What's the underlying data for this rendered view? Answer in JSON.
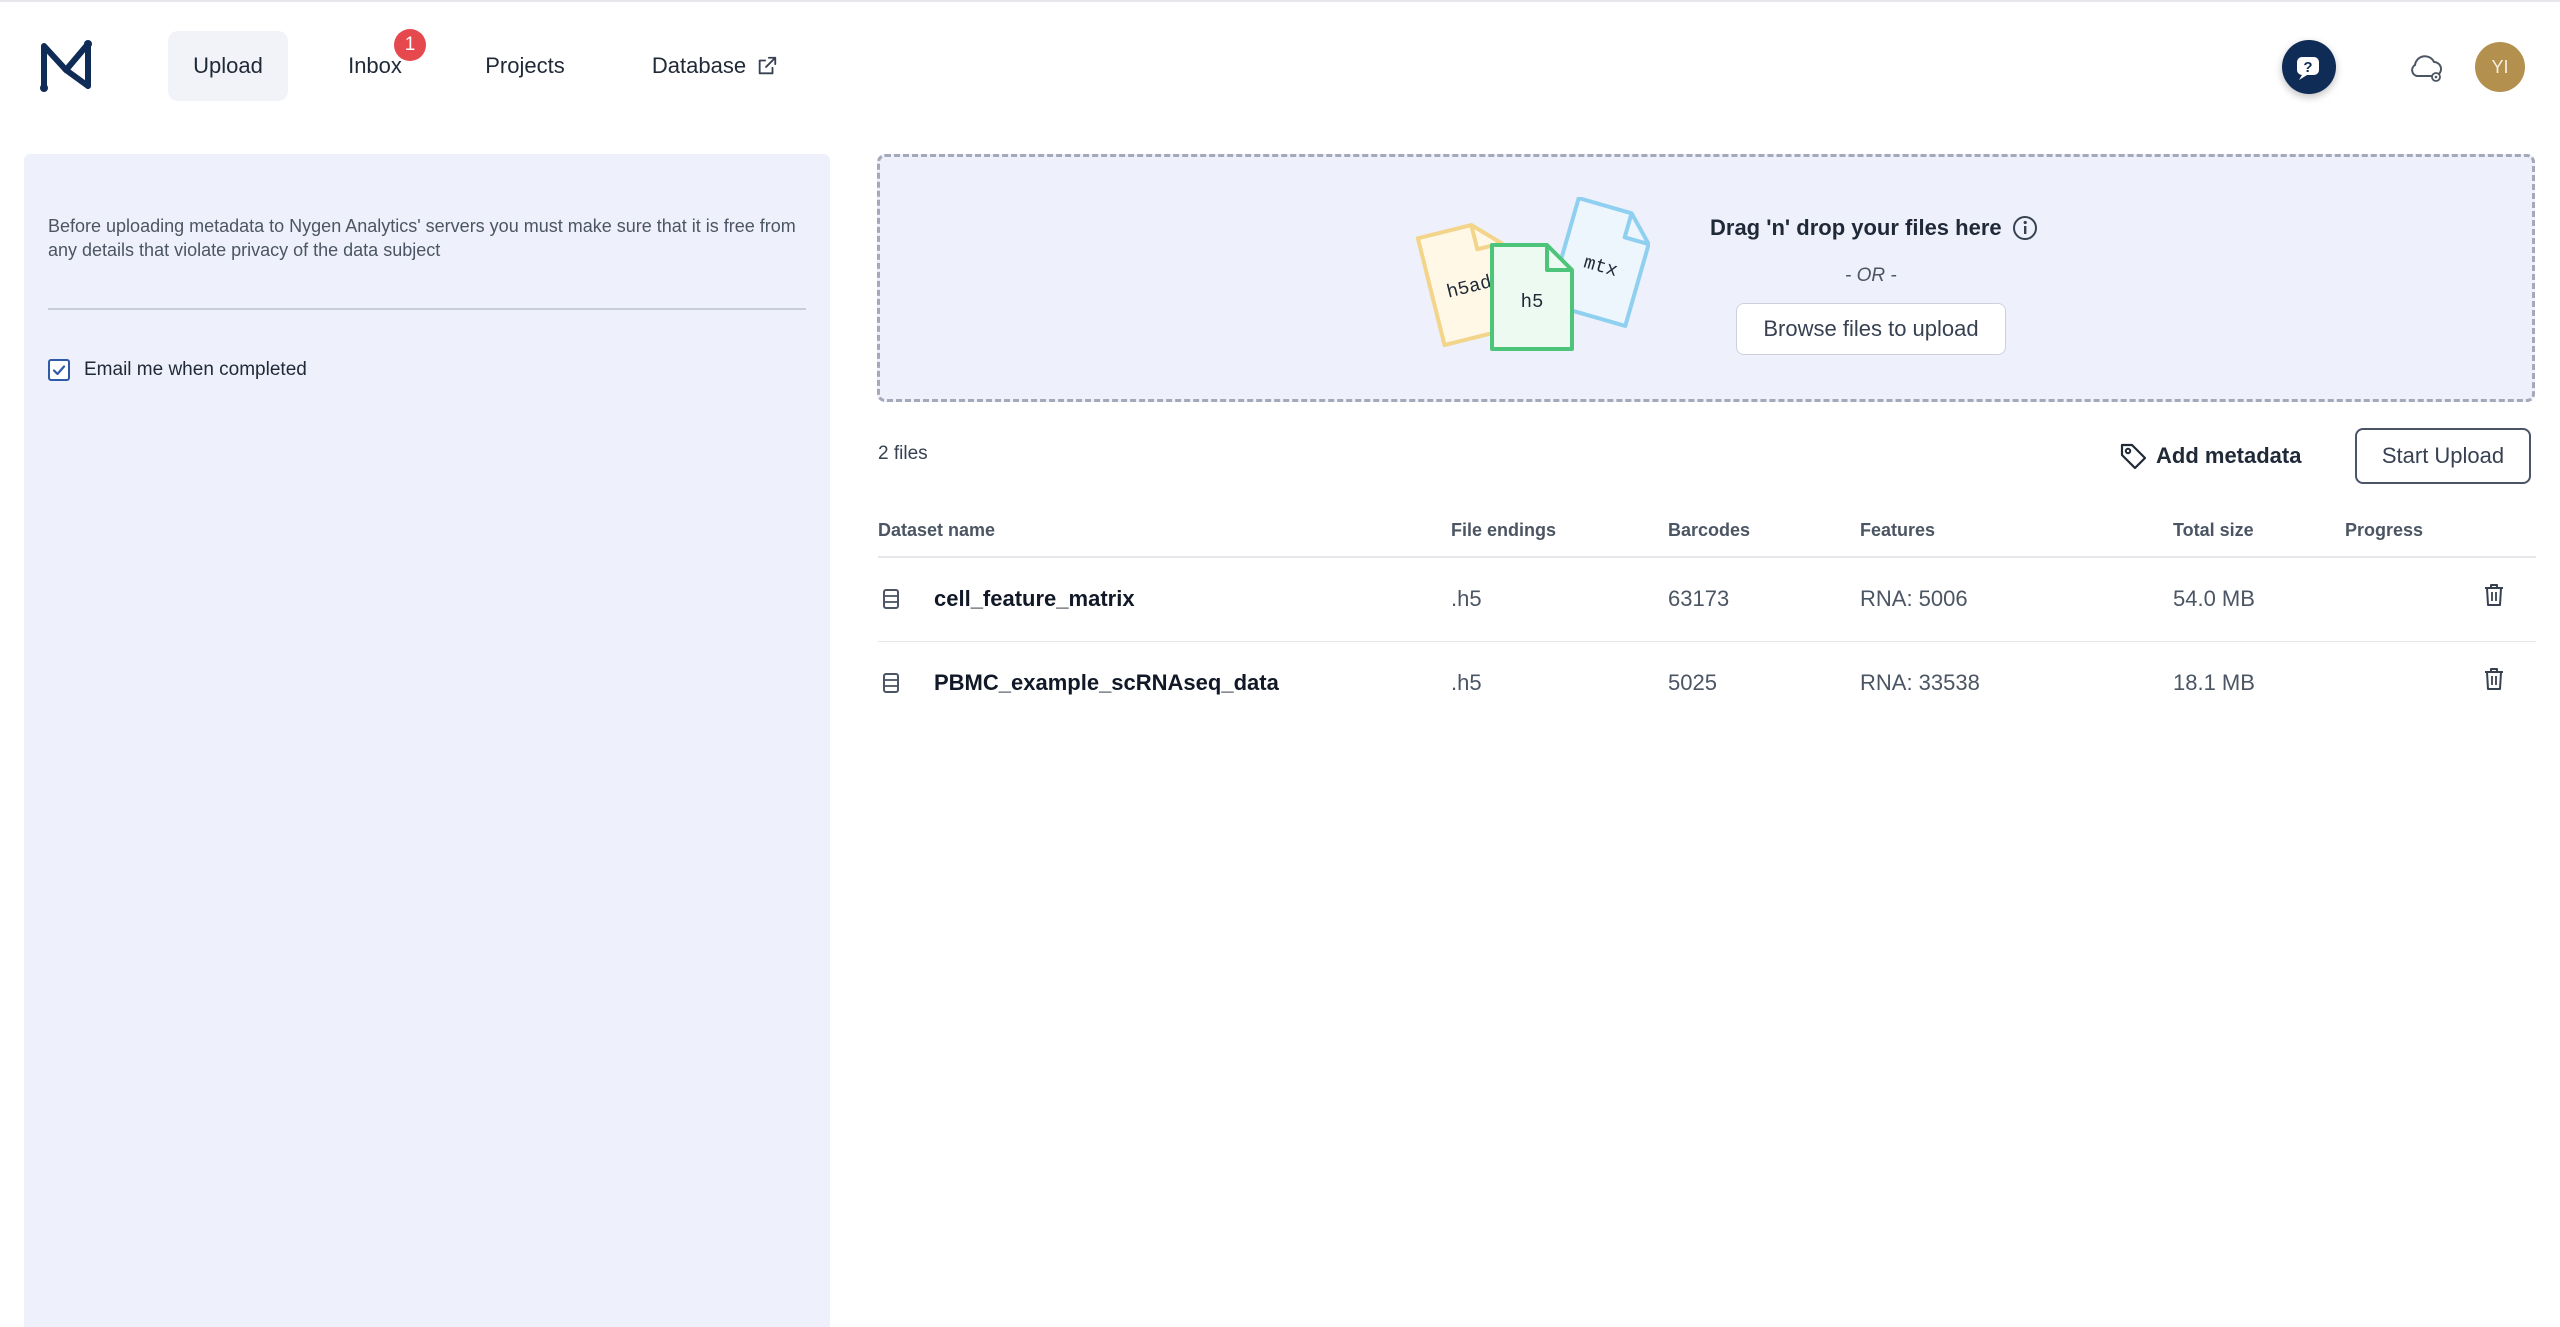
{
  "nav": {
    "upload": "Upload",
    "inbox": "Inbox",
    "inbox_badge": "1",
    "projects": "Projects",
    "database": "Database"
  },
  "header": {
    "avatar_initials": "YI",
    "help_icon": "help-chat-icon",
    "cloud_icon": "cloud-settings-icon"
  },
  "left_panel": {
    "privacy_text": "Before uploading metadata to Nygen Analytics' servers you must make sure that it is free from any details that violate privacy of the data subject",
    "email_checkbox_label": "Email me when completed",
    "email_checked": true
  },
  "dropzone": {
    "title": "Drag 'n' drop your files here",
    "or_text": "- OR -",
    "browse_label": "Browse files to upload",
    "file_labels": [
      "h5ad",
      "h5",
      "mtx"
    ]
  },
  "toolbar": {
    "files_count": "2 files",
    "add_metadata": "Add metadata",
    "start_upload": "Start Upload"
  },
  "table": {
    "headers": {
      "name": "Dataset name",
      "endings": "File endings",
      "barcodes": "Barcodes",
      "features": "Features",
      "size": "Total size",
      "progress": "Progress"
    },
    "rows": [
      {
        "name": "cell_feature_matrix",
        "endings": ".h5",
        "barcodes": "63173",
        "features": "RNA: 5006",
        "size": "54.0 MB"
      },
      {
        "name": "PBMC_example_scRNAseq_data",
        "endings": ".h5",
        "barcodes": "5025",
        "features": "RNA: 33538",
        "size": "18.1 MB"
      }
    ]
  },
  "colors": {
    "accent_navy": "#0f2c57",
    "badge_red": "#e5484d",
    "panel_bg": "#eef1fb",
    "avatar_bg": "#b3904e"
  }
}
